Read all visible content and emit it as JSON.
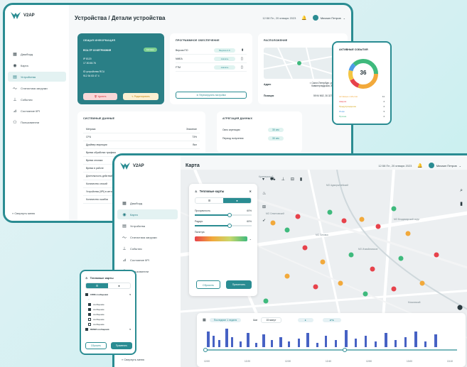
{
  "back": {
    "logo": "V2AP",
    "title": "Устройства / Детали устройства",
    "date": "12:58  Пн, 20 января 2023",
    "user": "Михаил Петров",
    "nav": [
      {
        "icon": "▦",
        "label": "Дашборд"
      },
      {
        "icon": "◉",
        "label": "Карта"
      },
      {
        "icon": "▤",
        "label": "Устройства"
      },
      {
        "icon": "〜",
        "label": "Статистика загрузки"
      },
      {
        "icon": "⊥",
        "label": "События"
      },
      {
        "icon": "⊿",
        "label": "Состояние IIPI"
      },
      {
        "icon": "⚇",
        "label": "Пользователи"
      }
    ],
    "collapse": "Свернуть меню",
    "general": {
      "title": "ОБЩАЯ ИНФОРМАЦИЯ",
      "device": "RCU-ТР 15 КЕТРИХНИЯ",
      "status": "Активен",
      "line1": "IP 8120",
      "line2": "17.50.58.76",
      "line3": "ID устройства RCU",
      "line4": "912 54 83 47 4",
      "delete": "Удалить",
      "edit": "Редактировать"
    },
    "software": {
      "title": "ПРОГРАММНОЕ ОБЕСПЕЧЕНИЕ",
      "rows": [
        {
          "name": "Версия ПО",
          "tag": "Версия 2.0"
        },
        {
          "name": "NMEA",
          "tag": "скачать"
        },
        {
          "name": "FTM",
          "tag": "скачать"
        }
      ],
      "button": "Перезагрузить настройки"
    },
    "location": {
      "title": "РАСПОЛОЖЕНИЕ",
      "addr_label": "Адрес",
      "addr_value": "г. Санкт-Петербург, ул. Кавалергардская, 80",
      "pos_label": "Позиция",
      "pos_value": "59.94 N52, 30.3274"
    },
    "system": {
      "title": "СИСТЕМНЫЕ ДАННЫЕ",
      "rows": [
        {
          "k": "Метрика",
          "v": "Значение"
        },
        {
          "k": "CPU",
          "v": "73%"
        },
        {
          "k": "Драйвер эмуляции",
          "v": "Вкл"
        },
        {
          "k": "Время обработки трафика",
          "v": ""
        },
        {
          "k": "Время отклика",
          "v": ""
        },
        {
          "k": "Время в работе",
          "v": ""
        },
        {
          "k": "Длительность действий",
          "v": ""
        },
        {
          "k": "Количество сессий",
          "v": ""
        },
        {
          "k": "Устройства (IIPI) в сети",
          "v": ""
        },
        {
          "k": "Количество ошибок",
          "v": ""
        }
      ]
    },
    "aggregation": {
      "title": "АГРЕГАЦИЯ ДАННЫХ",
      "rows": [
        {
          "k": "Окно агрегации",
          "v": "30 сек"
        },
        {
          "k": "Период получения",
          "v": "30 сек"
        }
      ]
    }
  },
  "events": {
    "title": "АКТИВНЫЕ СОБЫТИЯ",
    "total": "36",
    "items": [
      {
        "label": "Активные события",
        "count": "11",
        "color": "#f2a93b"
      },
      {
        "label": "Авария",
        "count": "4",
        "color": "#e7424b"
      },
      {
        "label": "Предупреждение",
        "count": "4",
        "color": "#f4c542"
      },
      {
        "label": "Инфо",
        "count": "3",
        "color": "#4d9be6"
      },
      {
        "label": "Прочие",
        "count": "4",
        "color": "#3fba7d"
      }
    ]
  },
  "front": {
    "logo": "V2AP",
    "title": "Карта",
    "date": "12:58  Пн, 20 января 2023",
    "user": "Михаил Петров",
    "nav": [
      {
        "icon": "▦",
        "label": "Дашборд"
      },
      {
        "icon": "◉",
        "label": "Карта"
      },
      {
        "icon": "▤",
        "label": "Устройства"
      },
      {
        "icon": "〜",
        "label": "Статистика загрузки"
      },
      {
        "icon": "⊥",
        "label": "События"
      },
      {
        "icon": "⊿",
        "label": "Состояние IIPI"
      },
      {
        "icon": "⚇",
        "label": "Пользователи"
      }
    ],
    "collapse": "Свернуть меню",
    "heat": {
      "title": "Тепловые карты",
      "opacity_label": "Прозрачность",
      "opacity_value": "60%",
      "radius_label": "Радиус",
      "radius_value": "60%",
      "palette_label": "Палитра",
      "reset": "Сбросить",
      "apply": "Применить"
    },
    "map_labels": [
      "МО Адмиралтейский",
      "МО Измайловское",
      "МО Владимирский округ",
      "МО Семеновский",
      "МО Лиговка",
      "Московский",
      "Кронверкский"
    ],
    "timeline": {
      "filter": "Последние 1 неделя",
      "step_label": "Шаг",
      "step_value": "15 минут",
      "ticks": [
        "12:00",
        "12:20",
        "12:30",
        "12:40",
        "12:50",
        "13:00",
        "13:10"
      ]
    }
  },
  "mini_heat": {
    "title": "Тепловые карты",
    "group1": "CWM сообщения",
    "group1_count": "5",
    "items": [
      "сообщение",
      "сообщение",
      "сообщение",
      "сообщение",
      "сообщение"
    ],
    "group2": "DENM сообщения",
    "group2_count": "5",
    "reset": "Сбросить",
    "apply": "Применить"
  },
  "colors": {
    "teal": "#2a8c92",
    "dark_teal": "#2a7f86",
    "red": "#e7424b",
    "orange": "#f2a93b",
    "green": "#3fba7d"
  }
}
